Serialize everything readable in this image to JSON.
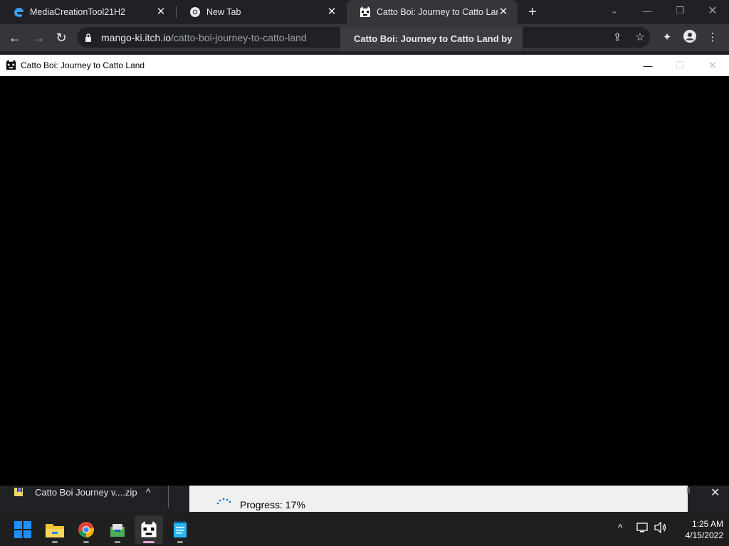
{
  "browser": {
    "tabs": [
      {
        "title": "MediaCreationTool21H2",
        "icon": "edge-icon"
      },
      {
        "title": "New Tab",
        "icon": "chrome-icon"
      },
      {
        "title": "Catto Boi: Journey to Catto Land",
        "icon": "catto-icon",
        "active": true
      }
    ],
    "url_domain": "mango-ki.itch.io",
    "url_path": "/catto-boi-journey-to-catto-land",
    "tooltip": "Catto Boi: Journey to Catto Land by"
  },
  "game_window": {
    "title": "Catto Boi: Journey to Catto Land"
  },
  "downloads": {
    "filename": "Catto Boi Journey v....zip",
    "progress_text": "Progress: 17%",
    "progress_percent": 17
  },
  "taskbar": {
    "apps": [
      "start",
      "file-explorer",
      "chrome",
      "winrar",
      "catto-game",
      "notepad"
    ],
    "time": "1:25 AM",
    "date": "4/15/2022"
  },
  "colors": {
    "tabstrip": "#202124",
    "toolbar": "#35363a",
    "accent_start": "#1e90ff",
    "active_indicator": "#e8a6d8"
  }
}
